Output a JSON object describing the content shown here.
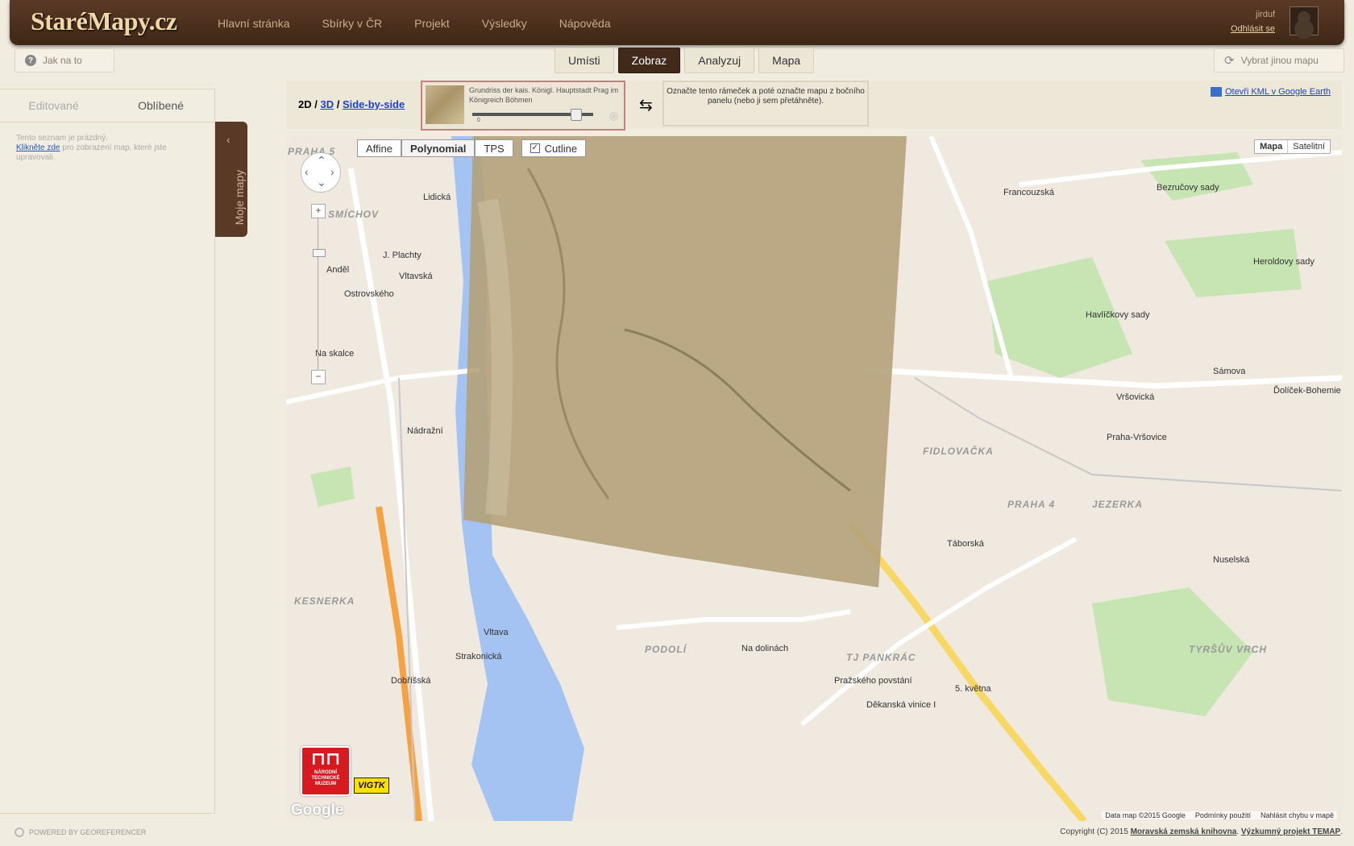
{
  "header": {
    "logo": "StaréMapy.cz",
    "nav": [
      "Hlavní stránka",
      "Sbírky v ČR",
      "Projekt",
      "Výsledky",
      "Nápověda"
    ],
    "user": {
      "name": "jirduf",
      "logout": "Odhlásit se"
    }
  },
  "subbar": {
    "help": "Jak na to",
    "tabs": [
      "Umísti",
      "Zobraz",
      "Analyzuj",
      "Mapa"
    ],
    "active_tab": "Zobraz",
    "change_map": "Vybrat jinou mapu"
  },
  "sidebar": {
    "tabs": [
      "Editované",
      "Oblíbené"
    ],
    "empty_text": "Tento seznam je prázdný.",
    "empty_link": "Klikněte zde",
    "empty_rest": "pro zobrazení map, které jste upravovali.",
    "handle_label": "Moje mapy"
  },
  "toolbar": {
    "mode_2d": "2D",
    "mode_3d": "3D",
    "mode_sbs": "Side-by-side",
    "map_title": "Grundriss der kais. Königl. Hauptstadt Prag im Königreich Böhmen",
    "slider_zero": "0",
    "hint": "Označte tento rámeček a poté označte mapu z bočního panelu (nebo ji sem přetáhněte).",
    "kml": "Otevři KML v Google Earth"
  },
  "map": {
    "methods": [
      "Affine",
      "Polynomial",
      "TPS"
    ],
    "selected_method": "Polynomial",
    "cutline": "Cutline",
    "map_types": [
      "Mapa",
      "Satelitní"
    ],
    "attribution": [
      "Data map ©2015 Google",
      "Podmínky použití",
      "Nahlásit chybu v mapě"
    ],
    "google": "Google",
    "ntm": "NÁRODNÍ TECHNICKÉ MUZEUM",
    "vigtk": "VIGTK",
    "labels": {
      "smichov": "SMÍCHOV",
      "andel": "Anděl",
      "lidicka": "Lidická",
      "plachty": "J. Plachty",
      "vltavska": "Vltavská",
      "ostrovskeho": "Ostrovského",
      "nadrazni": "Nádražní",
      "na_skalce": "Na skalce",
      "kesnerka": "KESNERKA",
      "dobrisska": "Dobříšská",
      "strakonicka": "Strakonická",
      "vltava": "Vltava",
      "podoli": "PODOLÍ",
      "na_dolinach": "Na dolinách",
      "tj_pankrac": "TJ PANKRÁC",
      "prazskeho": "Pražského povstání",
      "dekanska": "Děkanská vinice I",
      "kvetna": "5. května",
      "taborska": "Táborská",
      "praha4": "PRAHA 4",
      "jezerka": "JEZERKA",
      "fidlovacka": "FIDLOVAČKA",
      "vrsovicka": "Vršovická",
      "havlickovy": "Havlíčkovy sady",
      "bezrucovy": "Bezručovy sady",
      "heroldovy": "Heroldovy sady",
      "praha_vrsovice": "Praha-Vršovice",
      "francouzska": "Francouzská",
      "samova": "Sámova",
      "dolicek": "Ďolíček-Bohemie",
      "tyrsuv": "TYRŠŮV VRCH",
      "nuselska": "Nuselská",
      "praha5": "PRAHA 5"
    }
  },
  "footer": {
    "powered": "POWERED BY GEOREFERENCER",
    "copyright": "Copyright (C) 2015",
    "mzk": "Moravská zemská knihovna",
    "temap": "Výzkumný projekt TEMAP"
  },
  "colors": {
    "header_brown": "#4b2f1c",
    "active_tab": "#412a1a",
    "river": "#a4c3f2",
    "park": "#c7e4b3",
    "highway": "#f5a242",
    "main_road": "#f8d865"
  }
}
